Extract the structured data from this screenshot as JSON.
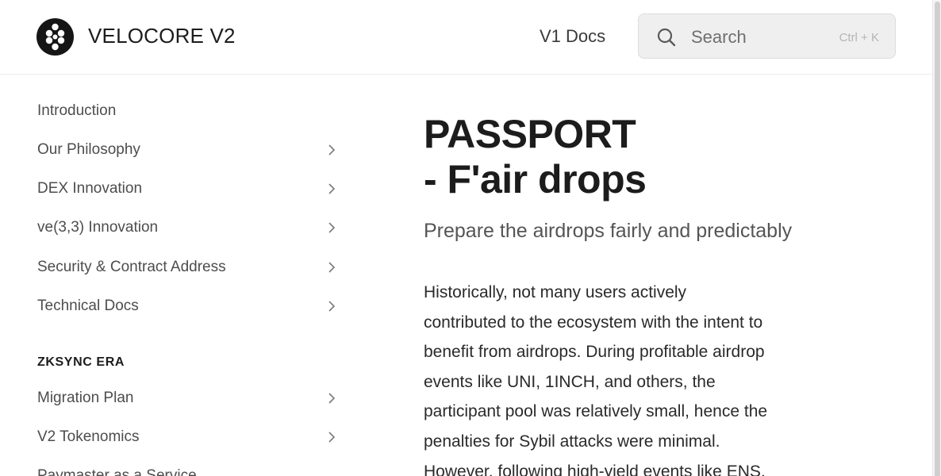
{
  "header": {
    "brand": "VELOCORE V2",
    "logo_icon": "velocore-logo-icon",
    "v1_docs_label": "V1 Docs",
    "search_placeholder": "Search",
    "search_shortcut": "Ctrl + K"
  },
  "sidebar": {
    "items": [
      {
        "label": "Introduction",
        "has_chevron": false
      },
      {
        "label": "Our Philosophy",
        "has_chevron": true
      },
      {
        "label": "DEX Innovation",
        "has_chevron": true
      },
      {
        "label": "ve(3,3) Innovation",
        "has_chevron": true
      },
      {
        "label": "Security & Contract Address",
        "has_chevron": true
      },
      {
        "label": "Technical Docs",
        "has_chevron": true
      }
    ],
    "section_title": "ZKSYNC ERA",
    "section_items": [
      {
        "label": "Migration Plan",
        "has_chevron": true
      },
      {
        "label": "V2 Tokenomics",
        "has_chevron": true
      },
      {
        "label": "Paymaster as a Service",
        "has_chevron": false
      }
    ]
  },
  "main": {
    "title_line1": "PASSPORT",
    "title_line2": "- F'air drops",
    "subtitle": "Prepare the airdrops fairly and predictably",
    "paragraph_lines": [
      "Historically, not many users actively",
      "contributed to the ecosystem with the intent to",
      "benefit from airdrops. During profitable airdrop",
      "events like UNI, 1INCH, and others, the",
      "participant pool was relatively small, hence the",
      "penalties for Sybil attacks were minimal.",
      "However, following high-yield events like ENS,"
    ]
  },
  "colors": {
    "text_primary": "#1c1c1c",
    "text_secondary": "#4d4d4d",
    "search_bg": "#efefef",
    "logo_bg": "#161616"
  }
}
